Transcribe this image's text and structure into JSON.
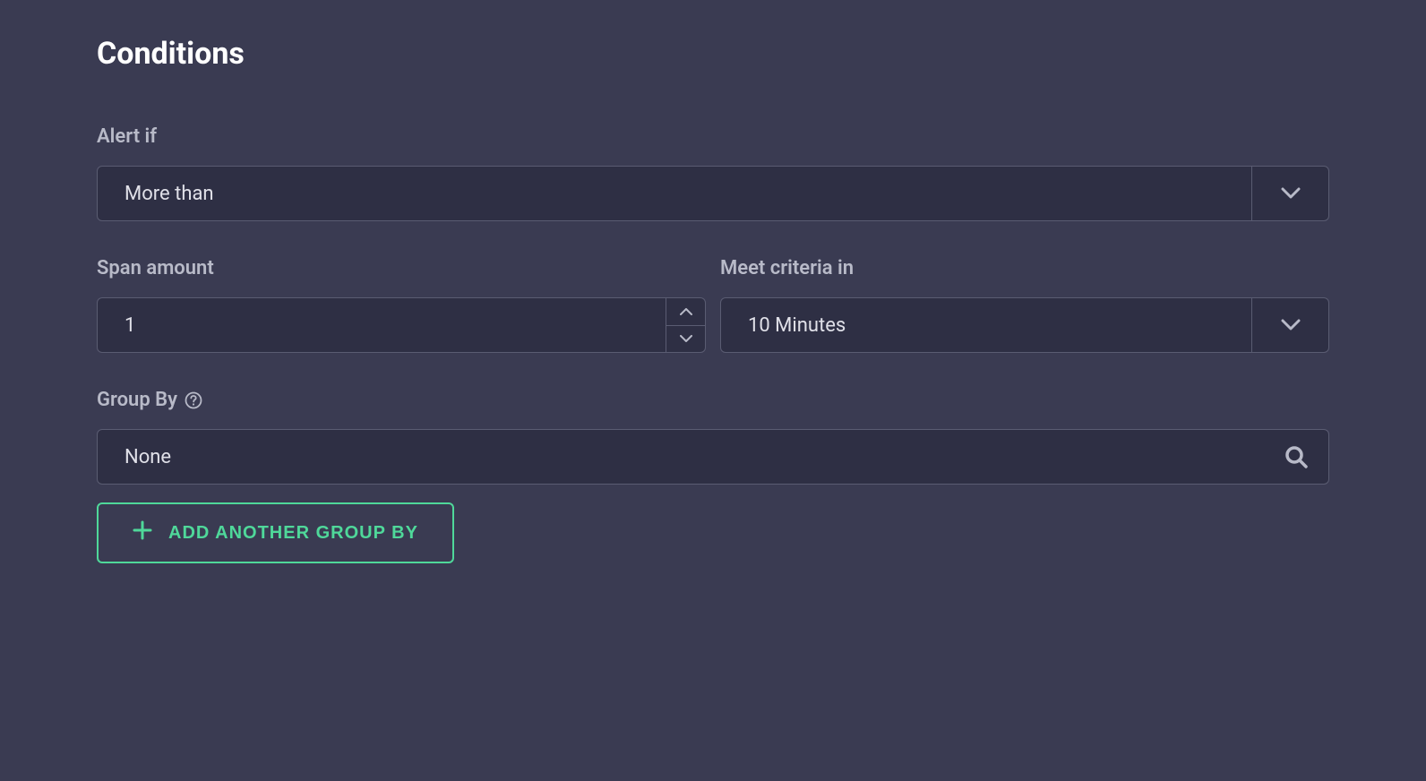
{
  "section": {
    "title": "Conditions"
  },
  "alertIf": {
    "label": "Alert if",
    "value": "More than"
  },
  "spanAmount": {
    "label": "Span amount",
    "value": "1"
  },
  "meetCriteria": {
    "label": "Meet criteria in",
    "value": "10 Minutes"
  },
  "groupBy": {
    "label": "Group By",
    "value": "None"
  },
  "addButton": {
    "label": "ADD ANOTHER GROUP BY"
  }
}
